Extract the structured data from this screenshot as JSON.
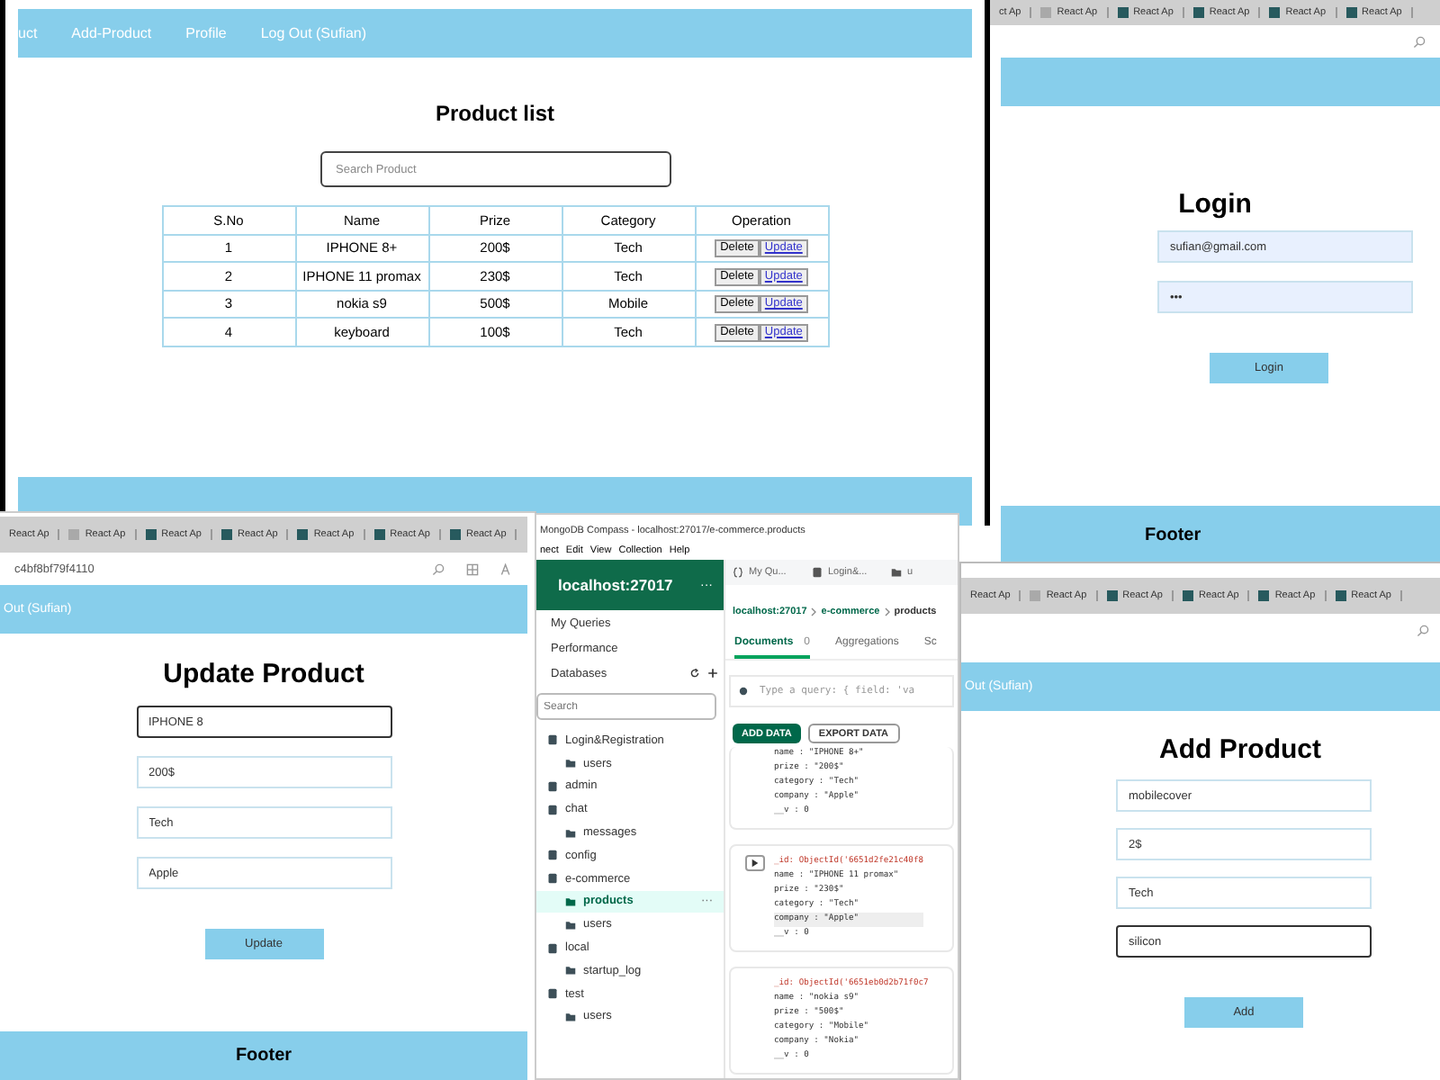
{
  "product_list_window": {
    "nav": [
      "uct",
      "Add-Product",
      "Profile",
      "Log Out (Sufian)"
    ],
    "title": "Product list",
    "search": {
      "placeholder": "Search Product"
    },
    "table": {
      "columns": [
        "S.No",
        "Name",
        "Prize",
        "Category",
        "Operation"
      ],
      "rows": [
        {
          "cells": [
            "1",
            "IPHONE 8+",
            "200$",
            "Tech"
          ],
          "actions": [
            "Delete",
            "Update"
          ]
        },
        {
          "cells": [
            "2",
            "IPHONE 11 promax",
            "230$",
            "Tech"
          ],
          "actions": [
            "Delete",
            "Update"
          ]
        },
        {
          "cells": [
            "3",
            "nokia s9",
            "500$",
            "Mobile"
          ],
          "actions": [
            "Delete",
            "Update"
          ]
        },
        {
          "cells": [
            "4",
            "keyboard",
            "100$",
            "Tech"
          ],
          "actions": [
            "Delete",
            "Update"
          ]
        }
      ]
    }
  },
  "login_window": {
    "tabs": [
      {
        "label": "ct Ap",
        "kind": "none"
      },
      {
        "label": "React Ap",
        "kind": "page"
      },
      {
        "label": "React Ap",
        "kind": "app"
      },
      {
        "label": "React Ap",
        "kind": "app"
      },
      {
        "label": "React Ap",
        "kind": "app"
      },
      {
        "label": "React Ap",
        "kind": "app"
      }
    ],
    "title": "Login",
    "fields": [
      {
        "value": "sufian@gmail.com",
        "focused": false
      },
      {
        "value": "•••",
        "focused": false
      }
    ],
    "button": "Login",
    "footer": "Footer"
  },
  "update_window": {
    "tabs": [
      {
        "label": "React Ap",
        "kind": "none"
      },
      {
        "label": "React Ap",
        "kind": "page"
      },
      {
        "label": "React Ap",
        "kind": "app"
      },
      {
        "label": "React Ap",
        "kind": "app"
      },
      {
        "label": "React Ap",
        "kind": "app"
      },
      {
        "label": "React Ap",
        "kind": "app"
      },
      {
        "label": "React Ap",
        "kind": "app"
      }
    ],
    "url": "c4bf8bf79f4110",
    "nav": [
      "Out (Sufian)"
    ],
    "title": "Update Product",
    "fields": [
      {
        "value": "IPHONE 8",
        "focused": true
      },
      {
        "value": "200$",
        "focused": false
      },
      {
        "value": "Tech",
        "focused": false
      },
      {
        "value": "Apple",
        "focused": false
      }
    ],
    "button": "Update",
    "footer": "Footer"
  },
  "compass_window": {
    "title": "MongoDB Compass - localhost:27017/e-commerce.products",
    "menu": [
      "nect",
      "Edit",
      "View",
      "Collection",
      "Help"
    ],
    "connection": "localhost:27017",
    "connection_more": "···",
    "nav": [
      "My Queries",
      "Performance",
      "Databases"
    ],
    "search": {
      "placeholder": "Search"
    },
    "tree": [
      {
        "label": "Login&Registration",
        "selected": false,
        "children": [
          {
            "label": "users",
            "selected": false
          }
        ]
      },
      {
        "label": "admin",
        "selected": false
      },
      {
        "label": "chat",
        "selected": false,
        "children": [
          {
            "label": "messages",
            "selected": false
          }
        ]
      },
      {
        "label": "config",
        "selected": false
      },
      {
        "label": "e-commerce",
        "selected": false,
        "children": [
          {
            "label": "products",
            "selected": true
          },
          {
            "label": "users",
            "selected": false
          }
        ]
      },
      {
        "label": "local",
        "selected": false,
        "children": [
          {
            "label": "startup_log",
            "selected": false
          }
        ]
      },
      {
        "label": "test",
        "selected": false,
        "children": [
          {
            "label": "users",
            "selected": false
          }
        ]
      }
    ],
    "item_more": "···",
    "open_tabs": [
      {
        "label": "My Qu...",
        "kind": "query"
      },
      {
        "label": "Login&...",
        "kind": "db"
      },
      {
        "label": "u",
        "kind": "folder"
      }
    ],
    "breadcrumb": [
      "localhost:27017",
      "e-commerce",
      "products"
    ],
    "doc_tabs": [
      {
        "label": "Documents",
        "count": "0",
        "selected": true
      },
      {
        "label": "Aggregations",
        "selected": false
      },
      {
        "label": "Sc",
        "selected": false
      }
    ],
    "query": {
      "placeholder": "Type a query: { field: 'va"
    },
    "actions": [
      {
        "label": "ADD DATA",
        "kind": "primary"
      },
      {
        "label": "EXPORT DATA",
        "kind": "secondary"
      }
    ],
    "documents": [
      {
        "expander": false,
        "lines": [
          {
            "text": "name : \"IPHONE 8+\"",
            "kind": "field",
            "highlighted": false
          },
          {
            "text": "prize : \"200$\"",
            "kind": "field",
            "highlighted": false
          },
          {
            "text": "category : \"Tech\"",
            "kind": "field",
            "highlighted": false
          },
          {
            "text": "company : \"Apple\"",
            "kind": "field",
            "highlighted": false
          },
          {
            "text": "__v : 0",
            "kind": "field",
            "highlighted": false
          }
        ]
      },
      {
        "expander": true,
        "lines": [
          {
            "text": "_id: ObjectId('6651d2fe21c40f8",
            "kind": "id",
            "highlighted": false
          },
          {
            "text": "name : \"IPHONE 11 promax\"",
            "kind": "field",
            "highlighted": false
          },
          {
            "text": "prize : \"230$\"",
            "kind": "field",
            "highlighted": false
          },
          {
            "text": "category : \"Tech\"",
            "kind": "field",
            "highlighted": false
          },
          {
            "text": "company : \"Apple\"",
            "kind": "field",
            "highlighted": true
          },
          {
            "text": "__v : 0",
            "kind": "field",
            "highlighted": false
          }
        ]
      },
      {
        "expander": false,
        "lines": [
          {
            "text": "_id: ObjectId('6651eb0d2b71f0c7",
            "kind": "id",
            "highlighted": false
          },
          {
            "text": "name : \"nokia s9\"",
            "kind": "field",
            "highlighted": false
          },
          {
            "text": "prize : \"500$\"",
            "kind": "field",
            "highlighted": false
          },
          {
            "text": "category : \"Mobile\"",
            "kind": "field",
            "highlighted": false
          },
          {
            "text": "company : \"Nokia\"",
            "kind": "field",
            "highlighted": false
          },
          {
            "text": "__v : 0",
            "kind": "field",
            "highlighted": false
          }
        ]
      }
    ]
  },
  "add_window": {
    "tabs": [
      {
        "label": "React Ap",
        "kind": "none"
      },
      {
        "label": "React Ap",
        "kind": "page"
      },
      {
        "label": "React Ap",
        "kind": "app"
      },
      {
        "label": "React Ap",
        "kind": "app"
      },
      {
        "label": "React Ap",
        "kind": "app"
      },
      {
        "label": "React Ap",
        "kind": "app"
      }
    ],
    "nav": [
      "Out (Sufian)"
    ],
    "title": "Add Product",
    "fields": [
      {
        "value": "mobilecover",
        "focused": false
      },
      {
        "value": "2$",
        "focused": false
      },
      {
        "value": "Tech",
        "focused": false
      },
      {
        "value": "silicon",
        "focused": true
      }
    ],
    "button": "Add"
  }
}
